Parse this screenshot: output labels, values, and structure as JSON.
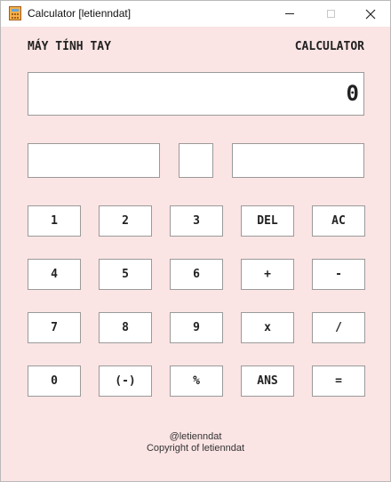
{
  "window": {
    "title": "Calculator [letienndat]",
    "app_icon": "calculator-icon",
    "controls": {
      "minimize": "minimize-icon",
      "maximize": "maximize-icon",
      "close": "✕"
    }
  },
  "header": {
    "left_label": "MÁY TÍNH TAY",
    "right_label": "CALCULATOR"
  },
  "display": {
    "value": "0"
  },
  "inputs": {
    "first_operand": "",
    "operator": "",
    "second_operand": ""
  },
  "keypad": {
    "rows": [
      [
        "1",
        "2",
        "3",
        "DEL",
        "AC"
      ],
      [
        "4",
        "5",
        "6",
        "+",
        "-"
      ],
      [
        "7",
        "8",
        "9",
        "x",
        "/"
      ],
      [
        "0",
        "(-)",
        "%",
        "ANS",
        "="
      ]
    ]
  },
  "footer": {
    "handle": "@letienndat",
    "copyright": "Copyright of letienndat"
  },
  "colors": {
    "background": "#fbe4e4",
    "field_bg": "#ffffff",
    "border": "#9a9a9a",
    "text": "#222222"
  }
}
